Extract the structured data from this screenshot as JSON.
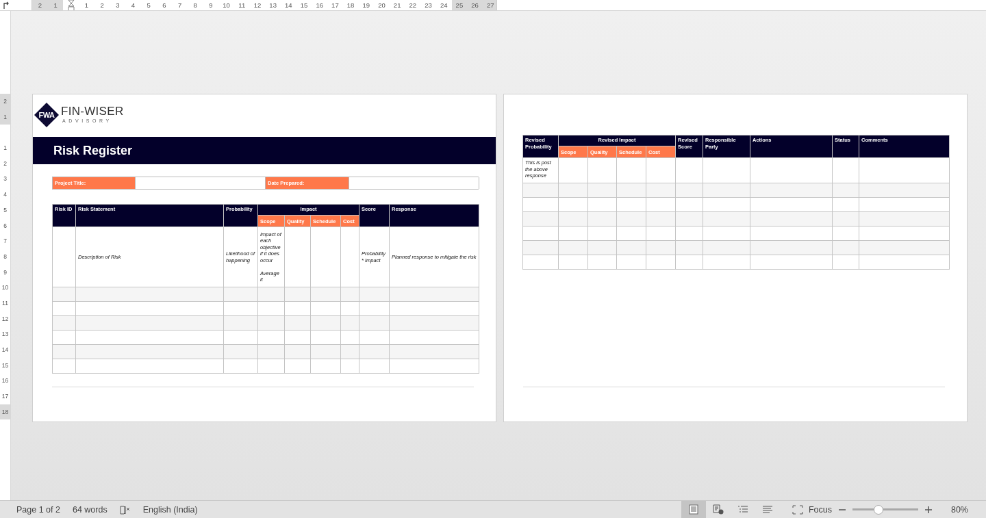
{
  "ruler": {
    "horizontal": [
      {
        "label": "2",
        "margin": true
      },
      {
        "label": "1",
        "margin": true
      },
      {
        "label": "1",
        "margin": false
      },
      {
        "label": "2",
        "margin": false
      },
      {
        "label": "3",
        "margin": false
      },
      {
        "label": "4",
        "margin": false
      },
      {
        "label": "5",
        "margin": false
      },
      {
        "label": "6",
        "margin": false
      },
      {
        "label": "7",
        "margin": false
      },
      {
        "label": "8",
        "margin": false
      },
      {
        "label": "9",
        "margin": false
      },
      {
        "label": "10",
        "margin": false
      },
      {
        "label": "11",
        "margin": false
      },
      {
        "label": "12",
        "margin": false
      },
      {
        "label": "13",
        "margin": false
      },
      {
        "label": "14",
        "margin": false
      },
      {
        "label": "15",
        "margin": false
      },
      {
        "label": "16",
        "margin": false
      },
      {
        "label": "17",
        "margin": false
      },
      {
        "label": "18",
        "margin": false
      },
      {
        "label": "19",
        "margin": false
      },
      {
        "label": "20",
        "margin": false
      },
      {
        "label": "21",
        "margin": false
      },
      {
        "label": "22",
        "margin": false
      },
      {
        "label": "23",
        "margin": false
      },
      {
        "label": "24",
        "margin": false
      },
      {
        "label": "25",
        "margin": true
      },
      {
        "label": "26",
        "margin": true
      },
      {
        "label": "27",
        "margin": true
      }
    ],
    "vertical": [
      {
        "label": "2",
        "margin": true
      },
      {
        "label": "1",
        "margin": true
      },
      {
        "label": "1",
        "margin": false
      },
      {
        "label": "2",
        "margin": false
      },
      {
        "label": "3",
        "margin": false
      },
      {
        "label": "4",
        "margin": false
      },
      {
        "label": "5",
        "margin": false
      },
      {
        "label": "6",
        "margin": false
      },
      {
        "label": "7",
        "margin": false
      },
      {
        "label": "8",
        "margin": false
      },
      {
        "label": "9",
        "margin": false
      },
      {
        "label": "10",
        "margin": false
      },
      {
        "label": "11",
        "margin": false
      },
      {
        "label": "12",
        "margin": false
      },
      {
        "label": "13",
        "margin": false
      },
      {
        "label": "14",
        "margin": false
      },
      {
        "label": "15",
        "margin": false
      },
      {
        "label": "16",
        "margin": false
      },
      {
        "label": "17",
        "margin": false
      },
      {
        "label": "18",
        "margin": true
      }
    ]
  },
  "pages": [
    {
      "logo": {
        "mark": "FWA",
        "name": "FIN-WISER",
        "tagline": "ADVISORY"
      },
      "title": "Risk Register",
      "fields": [
        {
          "label": "Project Title:"
        },
        {
          "label": "Date Prepared:"
        }
      ],
      "table": {
        "columns": [
          {
            "label": "Risk ID"
          },
          {
            "label": "Risk Statement"
          },
          {
            "label": "Probability"
          },
          {
            "label": "Impact",
            "children": [
              {
                "label": "Scope"
              },
              {
                "label": "Quality"
              },
              {
                "label": "Schedule"
              },
              {
                "label": "Cost"
              }
            ]
          },
          {
            "label": "Score"
          },
          {
            "label": "Response"
          }
        ],
        "rows": [
          [
            null,
            "Description of Risk",
            "Likelihood of happening",
            "Impact of each objective if it does occur\n\nAverage it",
            null,
            null,
            null,
            "Probability * Impact",
            "Planned response to mitigate the risk"
          ],
          [
            null,
            null,
            null,
            null,
            null,
            null,
            null,
            null,
            null
          ],
          [
            null,
            null,
            null,
            null,
            null,
            null,
            null,
            null,
            null
          ],
          [
            null,
            null,
            null,
            null,
            null,
            null,
            null,
            null,
            null
          ],
          [
            null,
            null,
            null,
            null,
            null,
            null,
            null,
            null,
            null
          ],
          [
            null,
            null,
            null,
            null,
            null,
            null,
            null,
            null,
            null
          ],
          [
            null,
            null,
            null,
            null,
            null,
            null,
            null,
            null,
            null
          ]
        ]
      }
    },
    {
      "table": {
        "columns": [
          {
            "label": "Revised Probability"
          },
          {
            "label": "Revised Impact",
            "children": [
              {
                "label": "Scope"
              },
              {
                "label": "Quality"
              },
              {
                "label": "Schedule"
              },
              {
                "label": "Cost"
              }
            ]
          },
          {
            "label": "Revised Score"
          },
          {
            "label": "Responsible Party"
          },
          {
            "label": "Actions"
          },
          {
            "label": "Status"
          },
          {
            "label": "Comments"
          }
        ],
        "rows": [
          [
            "This is post the above response",
            null,
            null,
            null,
            null,
            null,
            null,
            null,
            null,
            null
          ],
          [
            null,
            null,
            null,
            null,
            null,
            null,
            null,
            null,
            null,
            null
          ],
          [
            null,
            null,
            null,
            null,
            null,
            null,
            null,
            null,
            null,
            null
          ],
          [
            null,
            null,
            null,
            null,
            null,
            null,
            null,
            null,
            null,
            null
          ],
          [
            null,
            null,
            null,
            null,
            null,
            null,
            null,
            null,
            null,
            null
          ],
          [
            null,
            null,
            null,
            null,
            null,
            null,
            null,
            null,
            null,
            null
          ],
          [
            null,
            null,
            null,
            null,
            null,
            null,
            null,
            null,
            null,
            null
          ]
        ]
      }
    }
  ],
  "status_bar": {
    "page": "Page 1 of 2",
    "words": "64 words",
    "language": "English (India)",
    "views": [
      {
        "kind": "print",
        "selected": true
      },
      {
        "kind": "web",
        "selected": false
      },
      {
        "kind": "outline",
        "selected": false
      },
      {
        "kind": "draft",
        "selected": false
      }
    ],
    "focus": "Focus",
    "zoom": {
      "level": 0.4,
      "reading": "80%"
    }
  }
}
